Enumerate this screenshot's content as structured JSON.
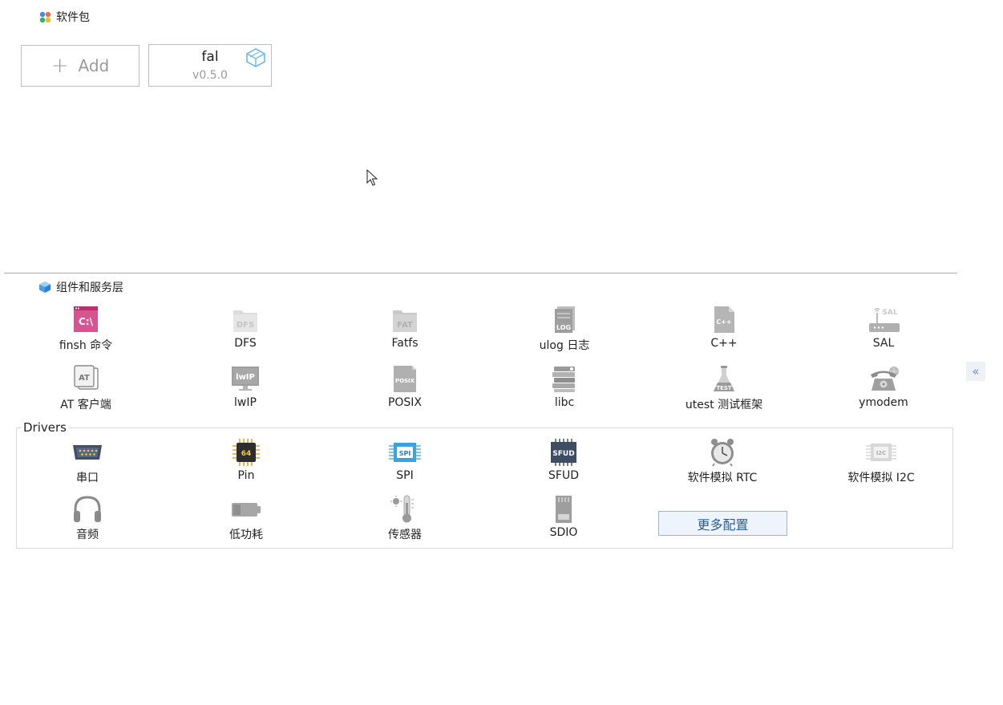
{
  "packages": {
    "title": "软件包",
    "add_label": "Add",
    "items": [
      {
        "name": "fal",
        "version": "v0.5.0"
      }
    ]
  },
  "components": {
    "title": "组件和服务层",
    "row1": [
      {
        "label": "finsh 命令",
        "icon": "finsh-icon"
      },
      {
        "label": "DFS",
        "icon": "dfs-folder-icon"
      },
      {
        "label": "Fatfs",
        "icon": "fat-folder-icon"
      },
      {
        "label": "ulog 日志",
        "icon": "log-file-icon"
      },
      {
        "label": "C++",
        "icon": "cpp-file-icon"
      },
      {
        "label": "SAL",
        "icon": "router-icon"
      }
    ],
    "row2": [
      {
        "label": "AT 客户端",
        "icon": "at-client-icon"
      },
      {
        "label": "lwIP",
        "icon": "lwip-monitor-icon"
      },
      {
        "label": "POSIX",
        "icon": "posix-file-icon"
      },
      {
        "label": "libc",
        "icon": "books-icon"
      },
      {
        "label": "utest 测试框架",
        "icon": "test-flask-icon"
      },
      {
        "label": "ymodem",
        "icon": "phone-icon"
      }
    ]
  },
  "drivers": {
    "title": "Drivers",
    "row1": [
      {
        "label": "串口",
        "icon": "serial-port-icon"
      },
      {
        "label": "Pin",
        "icon": "chip-icon"
      },
      {
        "label": "SPI",
        "icon": "spi-icon"
      },
      {
        "label": "SFUD",
        "icon": "sfud-chip-icon"
      },
      {
        "label": "软件模拟 RTC",
        "icon": "alarm-clock-icon"
      },
      {
        "label": "软件模拟 I2C",
        "icon": "i2c-icon"
      }
    ],
    "row2": [
      {
        "label": "音频",
        "icon": "headphones-icon"
      },
      {
        "label": "低功耗",
        "icon": "battery-icon"
      },
      {
        "label": "传感器",
        "icon": "thermometer-icon"
      },
      {
        "label": "SDIO",
        "icon": "sd-card-icon"
      }
    ],
    "more_label": "更多配置"
  },
  "collapse_label": "«"
}
